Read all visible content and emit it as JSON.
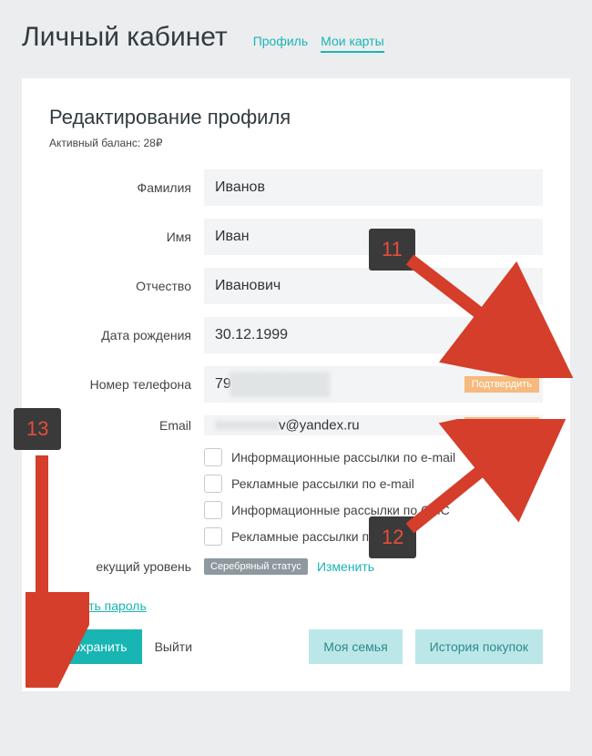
{
  "header": {
    "title": "Личный кабинет",
    "tabs": [
      {
        "label": "Профиль",
        "active": false
      },
      {
        "label": "Мои карты",
        "active": true
      }
    ]
  },
  "card": {
    "title": "Редактирование профиля",
    "balance": "Активный баланс: 28₽"
  },
  "form": {
    "lastname_label": "Фамилия",
    "lastname_value": "Иванов",
    "firstname_label": "Имя",
    "firstname_value": "Иван",
    "middlename_label": "Отчество",
    "middlename_value": "Иванович",
    "dob_label": "Дата рождения",
    "dob_value": "30.12.1999",
    "phone_label": "Номер телефона",
    "phone_prefix": "79",
    "email_label": "Email",
    "email_suffix": "v@yandex.ru",
    "confirm_label": "Подтвердить"
  },
  "checkboxes": [
    "Информационные рассылки по e-mail",
    "Рекламные рассылки по e-mail",
    "Информационные рассылки по СМС",
    "Рекламные рассылки по СМС"
  ],
  "level": {
    "label": "екущий уровень",
    "status": "Серебряный статус",
    "change": "Изменить"
  },
  "links": {
    "change_password": "Сменить пароль"
  },
  "buttons": {
    "save": "Сохранить",
    "logout": "Выйти",
    "family": "Моя семья",
    "history": "История покупок"
  },
  "annotations": {
    "n11": "11",
    "n12": "12",
    "n13": "13"
  },
  "colors": {
    "teal": "#18b5b3",
    "orange_badge": "#f6b97e",
    "arrow": "#d43e2a",
    "anno_bg": "#3a3a3a"
  }
}
